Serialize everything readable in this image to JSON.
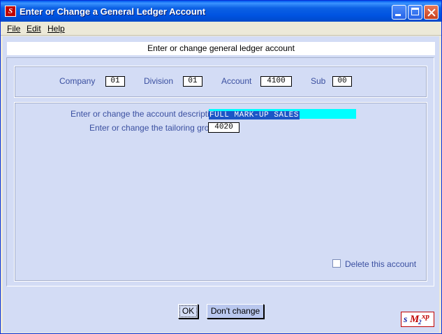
{
  "window": {
    "title": "Enter or Change a General Ledger Account"
  },
  "menu": {
    "file": "File",
    "edit": "Edit",
    "help": "Help"
  },
  "banner": "Enter or change general ledger account",
  "key": {
    "company_label": "Company",
    "company_value": "01",
    "division_label": "Division",
    "division_value": "01",
    "account_label": "Account",
    "account_value": "4100",
    "sub_label": "Sub",
    "sub_value": "00"
  },
  "form": {
    "description_label": "Enter or change the account description",
    "description_value": "FULL MARK-UP SALES",
    "tailoring_label": "Enter or change the tailoring group",
    "tailoring_value": "4020",
    "delete_label": "Delete this account",
    "delete_checked": false
  },
  "buttons": {
    "ok": "OK",
    "dont_change": "Don't change"
  },
  "logo": {
    "s": "s",
    "m": "M",
    "two": "2",
    "xp": "xp"
  },
  "colors": {
    "panel": "#d3dcf5",
    "label": "#3a4fa0",
    "highlight": "#00ffff",
    "selection": "#1c56c6"
  }
}
